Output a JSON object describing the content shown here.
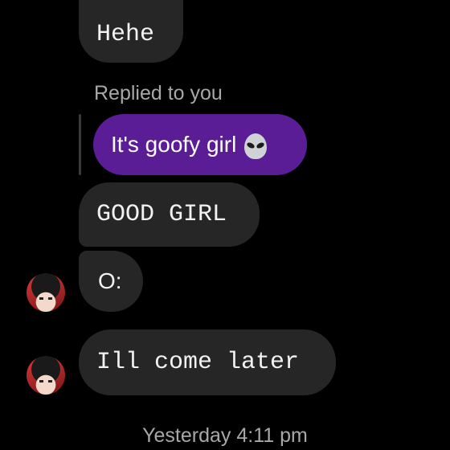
{
  "messages": [
    {
      "text": "Hehe"
    },
    {
      "reply_label": "Replied to you",
      "text": "It's goofy girl",
      "emoji_icon": "alien-face-icon"
    },
    {
      "text": "GOOD GIRL"
    },
    {
      "text": "O:"
    },
    {
      "text": "Ill come later"
    }
  ],
  "timestamp": "Yesterday 4:11 pm",
  "colors": {
    "background": "#000000",
    "incoming_bubble": "#262626",
    "outgoing_bubble": "#5b1d95",
    "meta_text": "#a8a8a8"
  }
}
